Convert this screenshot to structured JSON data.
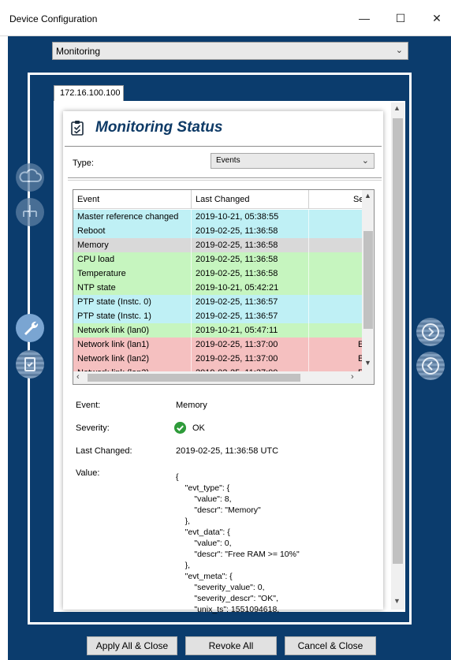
{
  "window": {
    "title": "Device Configuration",
    "minimize_glyph": "—",
    "maximize_glyph": "☐",
    "close_glyph": "✕"
  },
  "top_select": {
    "value": "Monitoring"
  },
  "tab": {
    "label": "172.16.100.100"
  },
  "page": {
    "title": "Monitoring Status",
    "title_icon": "clipboard-check-icon",
    "type_label": "Type:",
    "type_value": "Events"
  },
  "table": {
    "columns": [
      "Event",
      "Last Changed",
      "Se"
    ],
    "rows": [
      {
        "event": "Master reference changed",
        "changed": "2019-10-21, 05:38:55",
        "sev": "",
        "color": "#bff0f5"
      },
      {
        "event": "Reboot",
        "changed": "2019-02-25, 11:36:58",
        "sev": "",
        "color": "#bff0f5"
      },
      {
        "event": "Memory",
        "changed": "2019-02-25, 11:36:58",
        "sev": "",
        "color": "#d9d9d9"
      },
      {
        "event": "CPU load",
        "changed": "2019-02-25, 11:36:58",
        "sev": "",
        "color": "#c6f5bf"
      },
      {
        "event": "Temperature",
        "changed": "2019-02-25, 11:36:58",
        "sev": "",
        "color": "#c6f5bf"
      },
      {
        "event": "NTP state",
        "changed": "2019-10-21, 05:42:21",
        "sev": "",
        "color": "#c6f5bf"
      },
      {
        "event": "PTP state (Instc. 0)",
        "changed": "2019-02-25, 11:36:57",
        "sev": "",
        "color": "#bff0f5"
      },
      {
        "event": "PTP state (Instc. 1)",
        "changed": "2019-02-25, 11:36:57",
        "sev": "",
        "color": "#bff0f5"
      },
      {
        "event": "Network link (lan0)",
        "changed": "2019-10-21, 05:47:11",
        "sev": "",
        "color": "#c6f5bf"
      },
      {
        "event": "Network link (lan1)",
        "changed": "2019-02-25, 11:37:00",
        "sev": "E",
        "color": "#f5c0c0"
      },
      {
        "event": "Network link (lan2)",
        "changed": "2019-02-25, 11:37:00",
        "sev": "E",
        "color": "#f5c0c0"
      },
      {
        "event": "Network link (lan3)",
        "changed": "2019-02-25, 11:37:00",
        "sev": "E",
        "color": "#f5c0c0"
      }
    ]
  },
  "details": {
    "event_label": "Event:",
    "event_value": "Memory",
    "severity_label": "Severity:",
    "severity_value": "OK",
    "changed_label": "Last Changed:",
    "changed_value": "2019-02-25, 11:36:58 UTC",
    "value_label": "Value:",
    "value_json": "{\n    \"evt_type\": {\n        \"value\": 8,\n        \"descr\": \"Memory\"\n    },\n    \"evt_data\": {\n        \"value\": 0,\n        \"descr\": \"Free RAM >= 10%\"\n    },\n    \"evt_meta\": {\n        \"severity_value\": 0,\n        \"severity_descr\": \"OK\",\n        \"unix_ts\": 1551094618,"
  },
  "side_icons": {
    "left": [
      "cloud-icon",
      "network-icon",
      "wrench-icon",
      "clipboard-icon"
    ],
    "right": [
      "forward-icon",
      "back-icon"
    ]
  },
  "buttons": {
    "apply": "Apply All & Close",
    "revoke": "Revoke All",
    "cancel": "Cancel & Close"
  },
  "colors": {
    "frame": "#0b3c6d",
    "title": "#0e3a66",
    "row_info": "#bff0f5",
    "row_ok": "#c6f5bf",
    "row_error": "#f5c0c0",
    "row_selected": "#d9d9d9",
    "ok_icon": "#2e9b3a"
  }
}
